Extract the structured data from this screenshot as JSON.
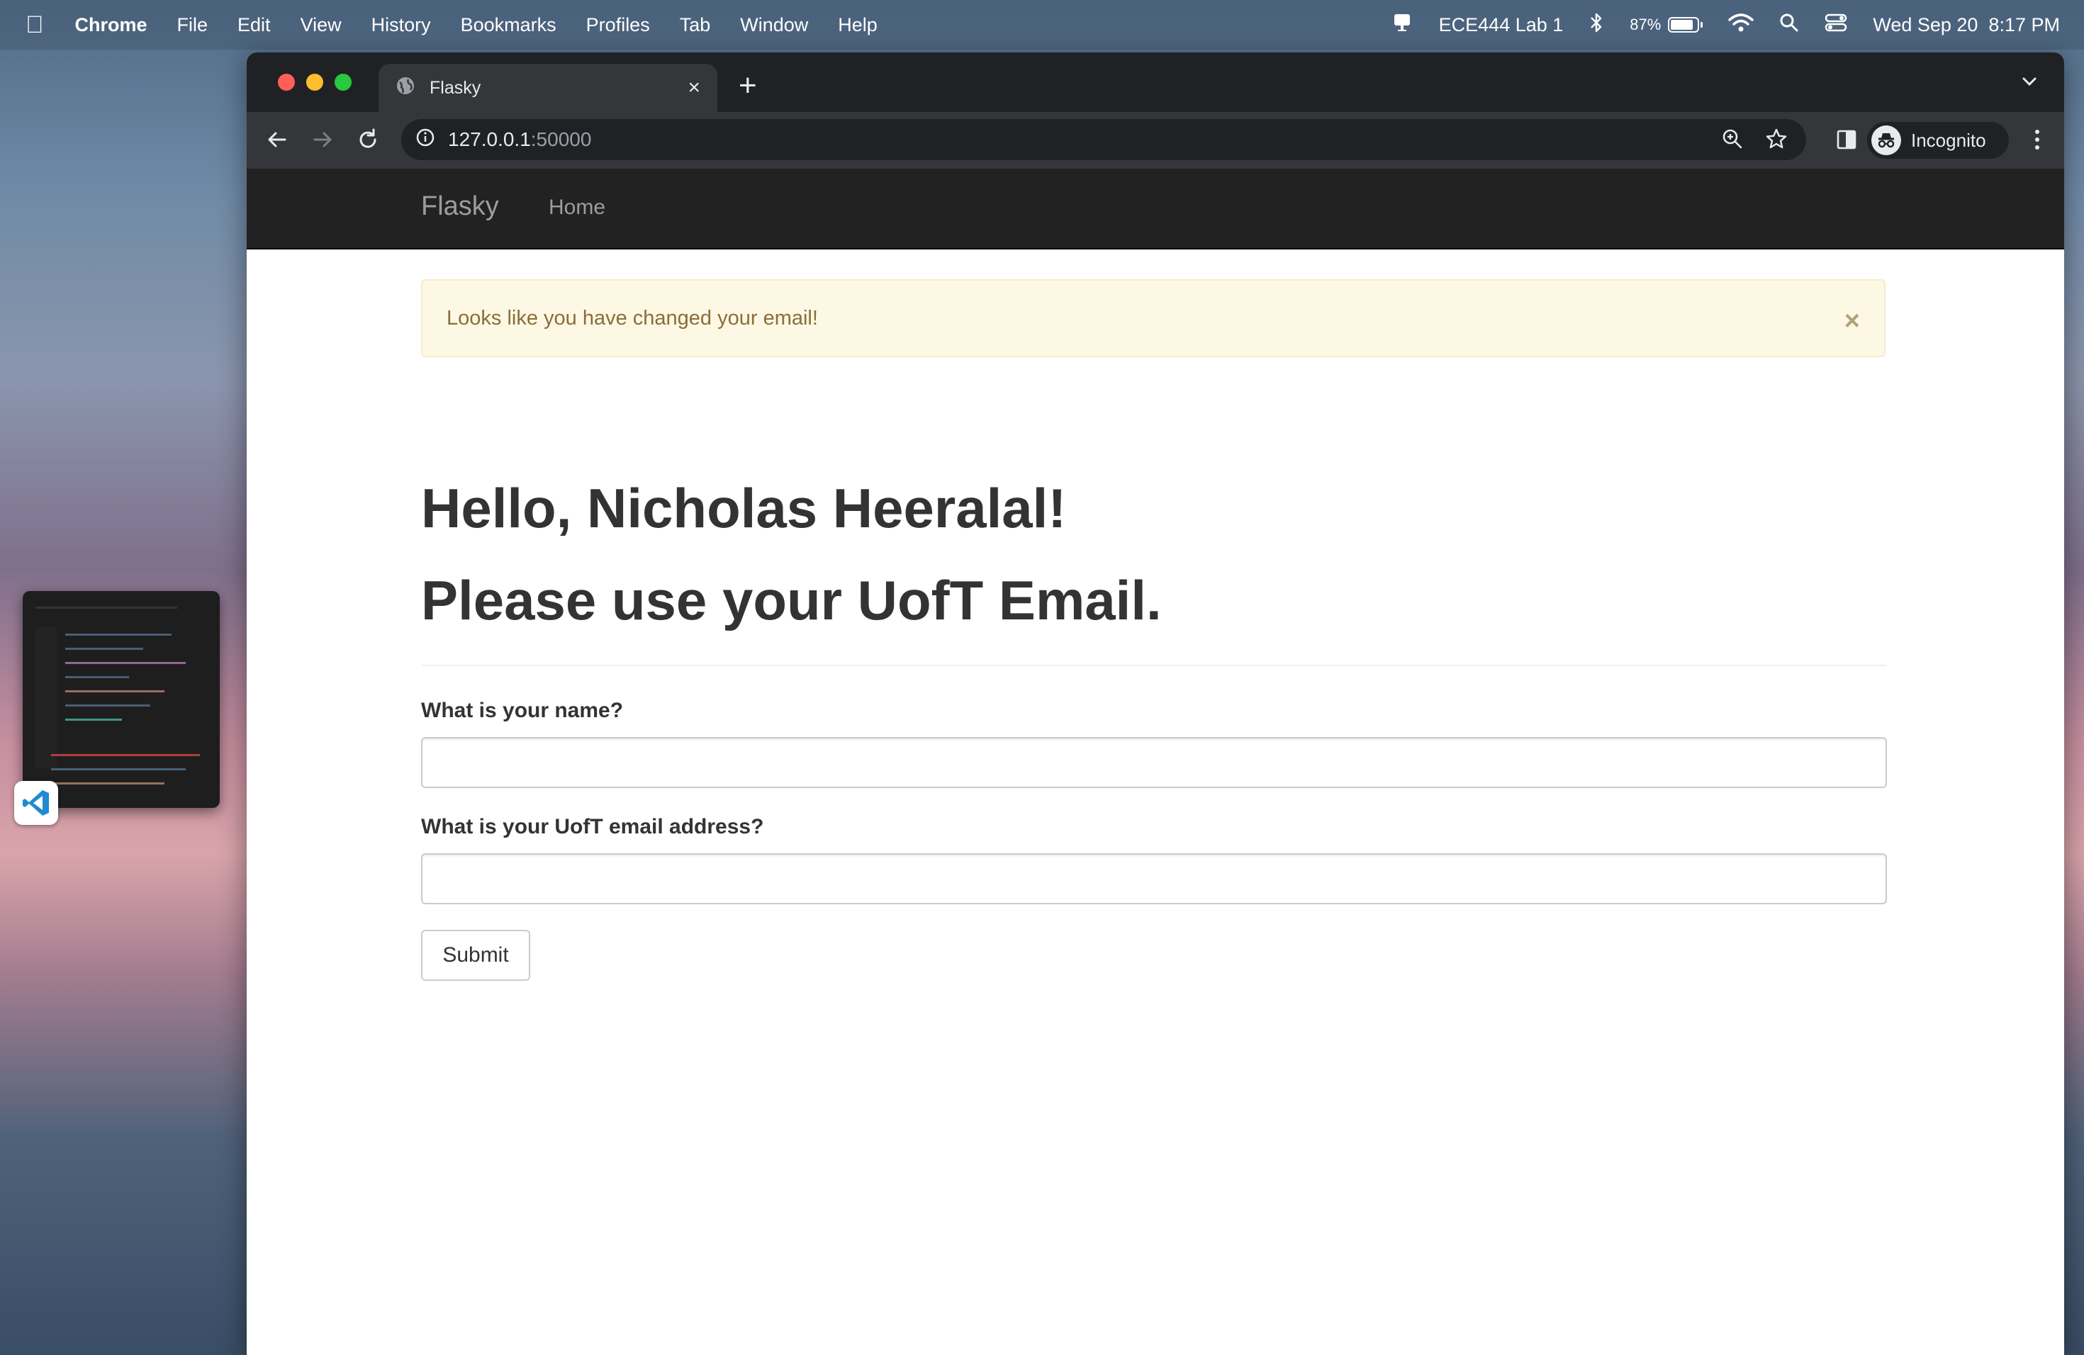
{
  "menubar": {
    "app_name": "Chrome",
    "menus": [
      "File",
      "Edit",
      "View",
      "History",
      "Bookmarks",
      "Profiles",
      "Tab",
      "Window",
      "Help"
    ],
    "status_title": "ECE444 Lab 1",
    "battery_percent": "87%",
    "battery_level": 0.87,
    "datetime": "Wed Sep 20  8:17 PM"
  },
  "browser": {
    "tab": {
      "title": "Flasky"
    },
    "omnibox": {
      "host": "127.0.0.1",
      "port": ":50000"
    },
    "profile_label": "Incognito"
  },
  "page": {
    "navbar": {
      "brand": "Flasky",
      "home": "Home"
    },
    "alert": {
      "message": "Looks like you have changed your email!",
      "close": "×"
    },
    "heading_line1": "Hello, Nicholas Heeralal!",
    "heading_line2": "Please use your UofT Email.",
    "form": {
      "name_label": "What is your name?",
      "name_value": "",
      "email_label": "What is your UofT email address?",
      "email_value": "",
      "submit_label": "Submit"
    }
  },
  "colors": {
    "navbar_bg": "#222222",
    "alert_bg": "#fcf8e3",
    "alert_text": "#8a6d3b",
    "chrome_dark": "#202124"
  }
}
